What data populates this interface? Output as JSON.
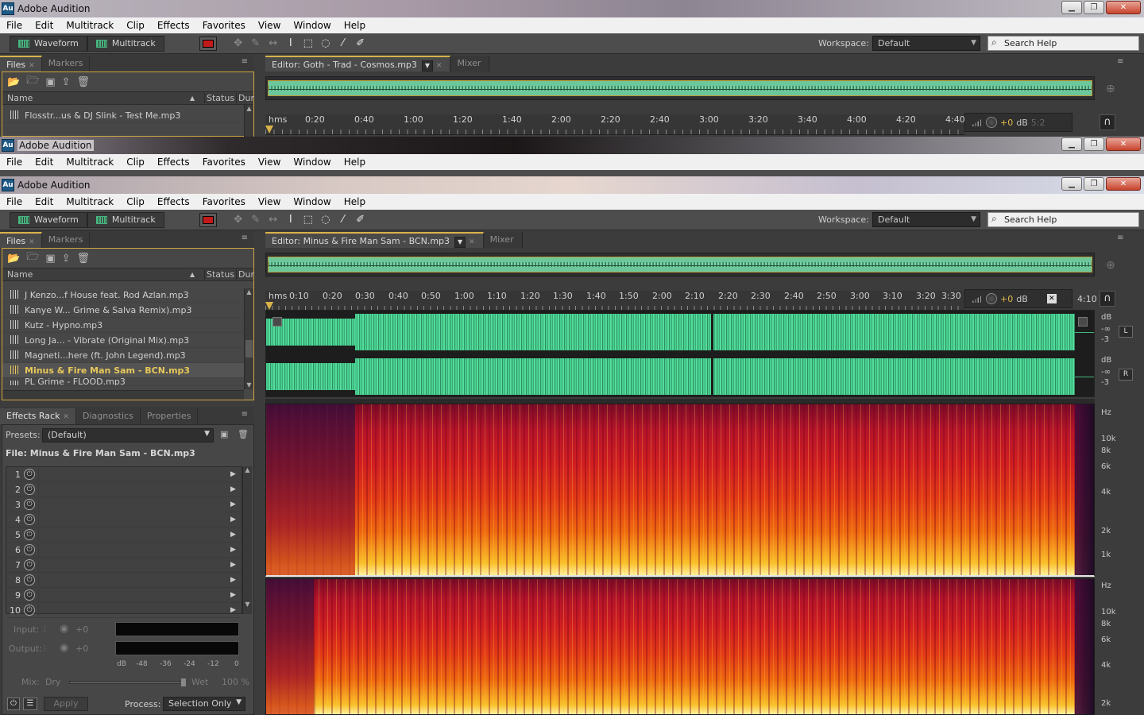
{
  "app": {
    "title": "Adobe Audition",
    "icon_text": "Au"
  },
  "menu": [
    "File",
    "Edit",
    "Multitrack",
    "Clip",
    "Effects",
    "Favorites",
    "View",
    "Window",
    "Help"
  ],
  "toolbar": {
    "waveform_label": "Waveform",
    "multitrack_label": "Multitrack",
    "workspace_label": "Workspace:",
    "workspace_value": "Default",
    "search_placeholder": "Search Help"
  },
  "window1": {
    "files_tab": "Files",
    "markers_tab": "Markers",
    "editor_tab": "Editor: Goth - Trad - Cosmos.mp3",
    "mixer_tab": "Mixer",
    "col_name": "Name",
    "col_status": "Status",
    "col_dur": "Dur",
    "files": [
      "Flosstr...us & DJ Slink - Test Me.mp3"
    ],
    "ruler": [
      "hms",
      "0:20",
      "0:40",
      "1:00",
      "1:20",
      "1:40",
      "2:00",
      "2:20",
      "2:40",
      "3:00",
      "3:20",
      "3:40",
      "4:00",
      "4:20",
      "4:40"
    ],
    "level_value": "+0",
    "level_unit": "dB",
    "ruler_end": "5:2"
  },
  "window3": {
    "files_tab": "Files",
    "markers_tab": "Markers",
    "editor_tab": "Editor: Minus & Fire Man Sam - BCN.mp3",
    "mixer_tab": "Mixer",
    "col_name": "Name",
    "col_status": "Status",
    "col_dur": "Dur",
    "files": [
      "J Kenzo...f House feat. Rod Azlan.mp3",
      "Kanye W... Grime & Salva Remix).mp3",
      "Kutz - Hypno.mp3",
      "Long Ja... - Vibrate (Original Mix).mp3",
      "Magneti...here (ft. John Legend).mp3",
      "Minus & Fire Man Sam - BCN.mp3",
      "PL Grime - FLOOD.mp3"
    ],
    "selected_file_index": 5,
    "ruler": [
      "hms",
      "0:10",
      "0:20",
      "0:30",
      "0:40",
      "0:50",
      "1:00",
      "1:10",
      "1:20",
      "1:30",
      "1:40",
      "1:50",
      "2:00",
      "2:10",
      "2:20",
      "2:30",
      "2:40",
      "2:50",
      "3:00",
      "3:10",
      "3:20",
      "3:30"
    ],
    "ruler_end": "4:10",
    "level_value": "+0",
    "level_unit": "dB",
    "wave_db_labels": [
      "dB",
      "-∞",
      "-3",
      "dB",
      "-∞",
      "-3"
    ],
    "channel_left": "L",
    "channel_right": "R",
    "spectral_top_labels": [
      "Hz",
      "10k",
      "8k",
      "6k",
      "4k",
      "2k",
      "1k"
    ],
    "spectral_bottom_labels": [
      "Hz",
      "10k",
      "8k",
      "6k",
      "4k",
      "2k"
    ]
  },
  "effects": {
    "tab_effects": "Effects Rack",
    "tab_diagnostics": "Diagnostics",
    "tab_properties": "Properties",
    "presets_label": "Presets:",
    "presets_value": "(Default)",
    "file_label": "File: Minus & Fire Man Sam - BCN.mp3",
    "slots": [
      "1",
      "2",
      "3",
      "4",
      "5",
      "6",
      "7",
      "8",
      "9",
      "10"
    ],
    "input_label": "Input:",
    "output_label": "Output:",
    "input_value": "+0",
    "output_value": "+0",
    "meter_scale": [
      "dB",
      "-48",
      "-36",
      "-24",
      "-12",
      "0"
    ],
    "mix_label": "Mix:",
    "mix_dry": "Dry",
    "mix_wet": "Wet",
    "mix_value": "100 %",
    "apply_label": "Apply",
    "process_label": "Process:",
    "process_value": "Selection Only"
  },
  "colors": {
    "accent": "#d8b24a",
    "waveform": "#47cf8f",
    "record": "#c21a1a"
  }
}
